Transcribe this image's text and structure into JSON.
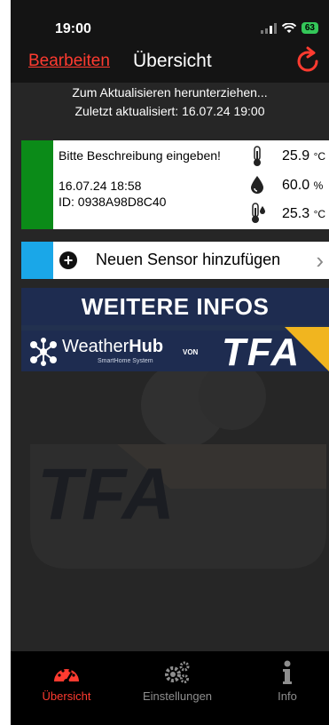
{
  "statusbar": {
    "time": "19:00",
    "battery": "63"
  },
  "navbar": {
    "edit_label": "Bearbeiten",
    "title": "Übersicht"
  },
  "refresh": {
    "pull_hint": "Zum Aktualisieren herunterziehen...",
    "last_updated": "Zuletzt aktualisiert: 16.07.24 19:00"
  },
  "sensor": {
    "description": "Bitte Beschreibung eingeben!",
    "datetime": "16.07.24   18:58",
    "id": "ID: 0938A98D8C40",
    "status_color": "#0b8b18",
    "readings": [
      {
        "icon": "thermometer-icon",
        "value": "25.9",
        "unit": "°C"
      },
      {
        "icon": "humidity-drop-icon",
        "value": "60.0",
        "unit": "%"
      },
      {
        "icon": "dewpoint-thermometer-icon",
        "value": "25.3",
        "unit": "°C"
      }
    ]
  },
  "add_sensor": {
    "label": "Neuen Sensor hinzufügen",
    "accent": "#1aa7e8"
  },
  "banner": {
    "title": "WEITERE INFOS",
    "brand_light": "Weather",
    "brand_bold": "Hub",
    "subtitle": "SmartHome System",
    "von": "VON",
    "logo": "TFA"
  },
  "tabs": [
    {
      "label": "Übersicht",
      "icon": "dashboard-gauge-icon",
      "active": true
    },
    {
      "label": "Einstellungen",
      "icon": "gears-icon",
      "active": false
    },
    {
      "label": "Info",
      "icon": "info-icon",
      "active": false
    }
  ],
  "colors": {
    "accent": "#ff3b30",
    "background": "#262626",
    "bar": "#141414"
  }
}
